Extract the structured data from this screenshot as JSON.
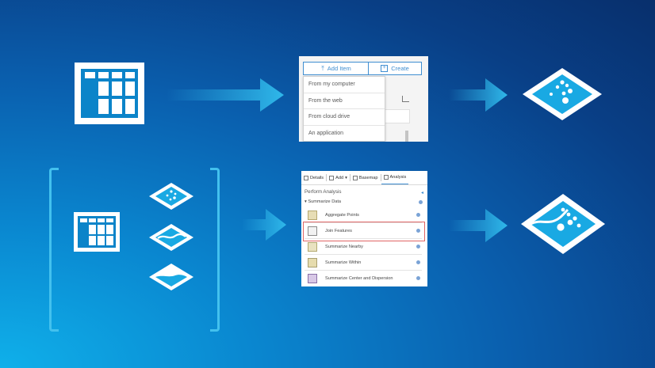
{
  "colors": {
    "accent": "#3f8ed1",
    "highlight": "#e06666",
    "arrow": "#2fb8ea",
    "layer_fill": "#19a9e3"
  },
  "top_row": {
    "add_menu": {
      "add_item_label": "Add Item",
      "create_label": "Create",
      "items": [
        "From my computer",
        "From the web",
        "From cloud drive",
        "An application"
      ]
    }
  },
  "bottom_row": {
    "analysis_panel": {
      "toolbar": [
        "Details",
        "Add",
        "Basemap",
        "Analysis"
      ],
      "heading": "Perform Analysis",
      "section": "Summarize Data",
      "tools": [
        "Aggregate Points",
        "Join Features",
        "Summarize Nearby",
        "Summarize Within",
        "Summarize Center and Dispersion"
      ]
    }
  },
  "icons": {
    "table": "table-icon",
    "arrow": "arrow-right-icon",
    "points_layer": "point-layer-icon",
    "line_layer": "line-layer-icon",
    "polygon_layer": "polygon-layer-icon",
    "joined_layer": "joined-layer-icon"
  }
}
